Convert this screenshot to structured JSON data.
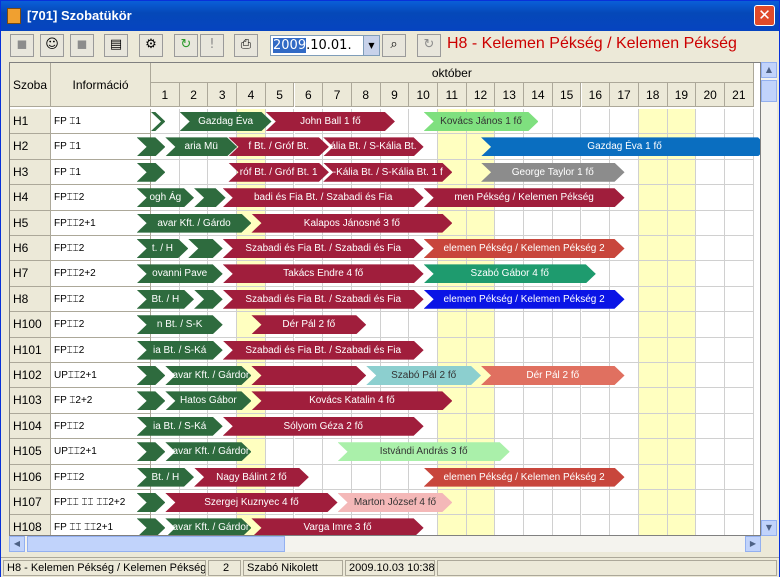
{
  "window": {
    "title": "[701] Szobatükör"
  },
  "toolbar": {
    "date_value": "2009.10.01.",
    "date_selected_part": "2009",
    "date_rest": ".10.01.",
    "title_text": "H8 - Kelemen Pékség / Kelemen Pékség"
  },
  "grid": {
    "header_room": "Szoba",
    "header_info": "Információ",
    "month": "október",
    "days": [
      "1",
      "2",
      "3",
      "4",
      "5",
      "6",
      "7",
      "8",
      "9",
      "10",
      "11",
      "12",
      "13",
      "14",
      "15",
      "16",
      "17",
      "18",
      "19",
      "20",
      "21"
    ],
    "weekend_days": [
      3,
      10,
      11,
      17,
      18
    ],
    "rooms": [
      {
        "room": "H1",
        "info": "FP ⌶1"
      },
      {
        "room": "H2",
        "info": "FP ⌶1"
      },
      {
        "room": "H3",
        "info": "FP ⌶1"
      },
      {
        "room": "H4",
        "info": "FP⌶⌶2"
      },
      {
        "room": "H5",
        "info": "FP⌶⌶2+1"
      },
      {
        "room": "H6",
        "info": "FP⌶⌶2"
      },
      {
        "room": "H7",
        "info": "FP⌶⌶2+2"
      },
      {
        "room": "H8",
        "info": "FP⌶⌶2"
      },
      {
        "room": "H100",
        "info": "FP⌶⌶2"
      },
      {
        "room": "H101",
        "info": "FP⌶⌶2"
      },
      {
        "room": "H102",
        "info": "UP⌶⌶2+1"
      },
      {
        "room": "H103",
        "info": "FP ⌶2+2"
      },
      {
        "room": "H104",
        "info": "FP⌶⌶2"
      },
      {
        "room": "H105",
        "info": "UP⌶⌶2+1"
      },
      {
        "room": "H106",
        "info": "FP⌶⌶2"
      },
      {
        "room": "H107",
        "info": "FP⌶⌶ ⌶⌶ ⌶⌶2+2"
      },
      {
        "room": "H108",
        "info": "FP ⌶⌶ ⌶⌶2+1"
      }
    ],
    "bookings": [
      {
        "row": 0,
        "start": 0,
        "end": 0.5,
        "color": "#2e6b3e",
        "text": ""
      },
      {
        "row": 0,
        "start": 1,
        "end": 4.2,
        "color": "#2e6b3e",
        "text": "Gazdag Éva"
      },
      {
        "row": 0,
        "start": 4,
        "end": 8.5,
        "color": "#a01e3c",
        "text": "John Ball 1 fő"
      },
      {
        "row": 0,
        "start": 9.5,
        "end": 13.5,
        "color": "#7fe07f",
        "text": "Kovács János 1 fő"
      },
      {
        "row": 1,
        "start": -0.5,
        "end": 0.5,
        "color": "#2e6b3e",
        "text": ""
      },
      {
        "row": 1,
        "start": 0.5,
        "end": 3,
        "color": "#2e6b3e",
        "text": "aria Mü"
      },
      {
        "row": 1,
        "start": 2.7,
        "end": 6.2,
        "color": "#a01e3c",
        "text": "f Bt. / Gróf Bt. "
      },
      {
        "row": 1,
        "start": 6,
        "end": 9.5,
        "color": "#a01e3c",
        "text": "ália Bt. / S-Kália Bt."
      },
      {
        "row": 1,
        "start": 11.5,
        "end": 21.5,
        "color": "#0a6ec0",
        "text": "Gazdag Éva 1 fő"
      },
      {
        "row": 2,
        "start": -0.5,
        "end": 0.5,
        "color": "#2e6b3e",
        "text": ""
      },
      {
        "row": 2,
        "start": 2.7,
        "end": 6.2,
        "color": "#a01e3c",
        "text": "róf Bt. / Gróf Bt. 1"
      },
      {
        "row": 2,
        "start": 6,
        "end": 10.5,
        "color": "#a01e3c",
        "text": "-Kália Bt. / S-Kália Bt. 1 f"
      },
      {
        "row": 2,
        "start": 11.5,
        "end": 16.5,
        "color": "#8c8c8c",
        "text": "George Taylor 1 fő"
      },
      {
        "row": 3,
        "start": -0.5,
        "end": 1.5,
        "color": "#2e6b3e",
        "text": "ogh Ág"
      },
      {
        "row": 3,
        "start": 1.5,
        "end": 2.6,
        "color": "#2e6b3e",
        "text": ""
      },
      {
        "row": 3,
        "start": 2.5,
        "end": 9.5,
        "color": "#a01e3c",
        "text": "badi és Fia Bt. / Szabadi és Fia"
      },
      {
        "row": 3,
        "start": 9.5,
        "end": 16.5,
        "color": "#a01e3c",
        "text": "men Pékség / Kelemen Pékség"
      },
      {
        "row": 4,
        "start": -0.5,
        "end": 3.5,
        "color": "#2e6b3e",
        "text": "avar Kft. / Gárdo"
      },
      {
        "row": 4,
        "start": 3.5,
        "end": 10.5,
        "color": "#a01e3c",
        "text": "Kalapos Jánosné 3 fő"
      },
      {
        "row": 5,
        "start": -0.5,
        "end": 1.3,
        "color": "#2e6b3e",
        "text": "t. / H"
      },
      {
        "row": 5,
        "start": 1.3,
        "end": 2.5,
        "color": "#2e6b3e",
        "text": ""
      },
      {
        "row": 5,
        "start": 2.5,
        "end": 9.5,
        "color": "#a01e3c",
        "text": "Szabadi és Fia Bt. / Szabadi és Fia"
      },
      {
        "row": 5,
        "start": 9.5,
        "end": 16.5,
        "color": "#c8463c",
        "text": "elemen Pékség / Kelemen Pékség 2"
      },
      {
        "row": 6,
        "start": -0.5,
        "end": 2.5,
        "color": "#2e6b3e",
        "text": "ovanni Pave"
      },
      {
        "row": 6,
        "start": 2.5,
        "end": 9.5,
        "color": "#a01e3c",
        "text": "Takács Endre 4 fő"
      },
      {
        "row": 6,
        "start": 9.5,
        "end": 15.5,
        "color": "#1e9b6e",
        "text": "Szabó Gábor 4 fő"
      },
      {
        "row": 7,
        "start": -0.5,
        "end": 1.5,
        "color": "#2e6b3e",
        "text": "Bt. / H"
      },
      {
        "row": 7,
        "start": 1.5,
        "end": 2.5,
        "color": "#2e6b3e",
        "text": ""
      },
      {
        "row": 7,
        "start": 2.5,
        "end": 9.5,
        "color": "#a01e3c",
        "text": "Szabadi és Fia Bt. / Szabadi és Fia"
      },
      {
        "row": 7,
        "start": 9.5,
        "end": 16.5,
        "color": "#0a14e6",
        "text": "elemen Pékség / Kelemen Pékség 2"
      },
      {
        "row": 8,
        "start": -0.5,
        "end": 2.5,
        "color": "#2e6b3e",
        "text": "n Bt. / S-K"
      },
      {
        "row": 8,
        "start": 3.5,
        "end": 7.5,
        "color": "#a01e3c",
        "text": "Dér Pál 2 fő"
      },
      {
        "row": 9,
        "start": -0.5,
        "end": 2.5,
        "color": "#2e6b3e",
        "text": "ia Bt. / S-Ká"
      },
      {
        "row": 9,
        "start": 2.5,
        "end": 9.5,
        "color": "#a01e3c",
        "text": "Szabadi és Fia Bt. / Szabadi és Fia"
      },
      {
        "row": 10,
        "start": -0.5,
        "end": 0.5,
        "color": "#2e6b3e",
        "text": ""
      },
      {
        "row": 10,
        "start": 0.5,
        "end": 3.5,
        "color": "#2e6b3e",
        "text": "savar Kft. / Gárdor"
      },
      {
        "row": 10,
        "start": 3.5,
        "end": 7.5,
        "color": "#a01e3c",
        "text": ""
      },
      {
        "row": 10,
        "start": 7.5,
        "end": 11.5,
        "color": "#8ccfcf",
        "text": "Szabó Pál 2 fő"
      },
      {
        "row": 10,
        "start": 11.5,
        "end": 16.5,
        "color": "#e07060",
        "text": "Dér Pál 2 fő"
      },
      {
        "row": 11,
        "start": -0.5,
        "end": 0.5,
        "color": "#2e6b3e",
        "text": ""
      },
      {
        "row": 11,
        "start": 0.5,
        "end": 3.5,
        "color": "#2e6b3e",
        "text": "Hatos Gábor"
      },
      {
        "row": 11,
        "start": 3.5,
        "end": 10.5,
        "color": "#a01e3c",
        "text": "Kovács Katalin 4 fő"
      },
      {
        "row": 12,
        "start": -0.5,
        "end": 2.5,
        "color": "#2e6b3e",
        "text": "ia Bt. / S-Ká"
      },
      {
        "row": 12,
        "start": 2.5,
        "end": 9.5,
        "color": "#a01e3c",
        "text": "Sólyom Géza 2 fő"
      },
      {
        "row": 13,
        "start": -0.5,
        "end": 0.5,
        "color": "#2e6b3e",
        "text": ""
      },
      {
        "row": 13,
        "start": 0.5,
        "end": 3.5,
        "color": "#2e6b3e",
        "text": "savar Kft. / Gárdor"
      },
      {
        "row": 13,
        "start": 6.5,
        "end": 12.5,
        "color": "#aaf0aa",
        "text": "Istvándi András 3 fő"
      },
      {
        "row": 14,
        "start": -0.5,
        "end": 1.5,
        "color": "#2e6b3e",
        "text": "Bt. / H"
      },
      {
        "row": 14,
        "start": 1.5,
        "end": 5.5,
        "color": "#a01e3c",
        "text": "Nagy Bálint 2 fő"
      },
      {
        "row": 14,
        "start": 9.5,
        "end": 16.5,
        "color": "#c8463c",
        "text": "elemen Pékség / Kelemen Pékség 2"
      },
      {
        "row": 15,
        "start": -0.5,
        "end": 0.5,
        "color": "#2e6b3e",
        "text": ""
      },
      {
        "row": 15,
        "start": 0.5,
        "end": 6.5,
        "color": "#a01e3c",
        "text": "Szergej Kuznyec 4 fő"
      },
      {
        "row": 15,
        "start": 6.5,
        "end": 10.5,
        "color": "#f4b8b8",
        "text": "Marton József 4 fő"
      },
      {
        "row": 16,
        "start": -0.5,
        "end": 0.5,
        "color": "#2e6b3e",
        "text": ""
      },
      {
        "row": 16,
        "start": 0.5,
        "end": 3.5,
        "color": "#2e6b3e",
        "text": "savar Kft. / Gárdor"
      },
      {
        "row": 16,
        "start": 3.5,
        "end": 9.5,
        "color": "#a01e3c",
        "text": "Varga Imre 3 fő"
      }
    ]
  },
  "status": {
    "booking": "H8 - Kelemen Pékség / Kelemen Pékség 2",
    "count": "2",
    "user": "Szabó Nikolett",
    "datetime": "2009.10.03 10:38"
  }
}
